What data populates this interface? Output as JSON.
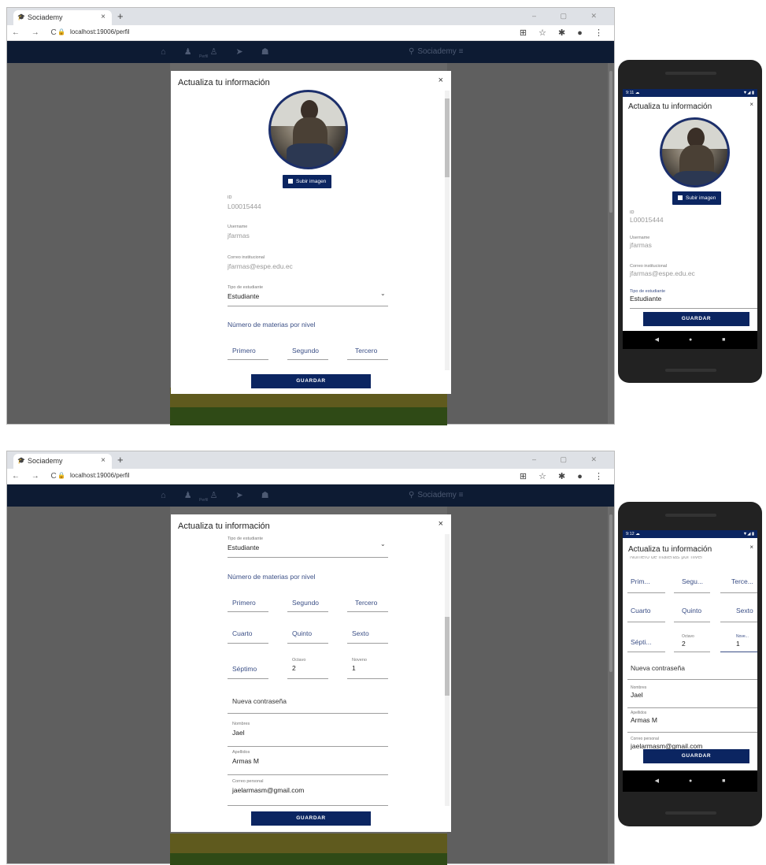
{
  "browser": {
    "tab_title": "Sociademy",
    "tab_close": "×",
    "new_tab": "+",
    "window_controls": "– ▢ ✕",
    "nav_buttons": "← → C",
    "url": "localhost:19006/perfil",
    "lock": "🔒",
    "extensions": "⊞ ☆ ✱ ● ⋮",
    "tab_favicon": "🎓"
  },
  "appnav": {
    "icons": "⌂ ♟ ♙ ➤ ☗",
    "perfil_label": "Perfil",
    "search_icon": "⚲",
    "brand": "Sociademy",
    "menu_icon": "≡"
  },
  "modal": {
    "title": "Actualiza tu información",
    "close": "×",
    "upload_button": "Subir imagen",
    "save_button": "GUARDAR",
    "fields": {
      "id_label": "ID",
      "id_value": "L00015444",
      "username_label": "Username",
      "username_value": "jfarmas",
      "correo_label": "Correo institucional",
      "correo_value": "jfarmas@espe.edu.ec",
      "tipo_label": "Tipo de estudiante",
      "tipo_value": "Estudiante",
      "materias_heading": "Número de materias por nivel",
      "primero": "Primero",
      "segundo": "Segundo",
      "tercero": "Tercero",
      "cuarto": "Cuarto",
      "quinto": "Quinto",
      "sexto": "Sexto",
      "septimo": "Séptimo",
      "octavo_label": "Octavo",
      "octavo_value": "2",
      "noveno_label": "Noveno",
      "noveno_value": "1",
      "nueva_contrasena": "Nueva contraseña",
      "nombres_label": "Nombres",
      "nombres_value": "Jael",
      "apellidos_label": "Apellidos",
      "apellidos_value": "Armas M",
      "correo_personal_label": "Correo personal",
      "correo_personal_value": "jaelarmasm@gmail.com"
    }
  },
  "phone1": {
    "time": "9:11 ☁",
    "status_right": "▼◢ ▮",
    "title": "Actualiza tu información",
    "close": "×",
    "upload_button": "Subir imagen",
    "save_button": "GUARDAR",
    "nav": "◀ ● ■"
  },
  "phone2": {
    "time": "9:12 ☁",
    "status_right": "▼◢ ▮",
    "title": "Actualiza tu información",
    "close": "×",
    "cut_text": "Número de materias por nivel",
    "primero": "Prim...",
    "segundo": "Segu...",
    "tercero": "Terce...",
    "cuarto": "Cuarto",
    "quinto": "Quinto",
    "sexto": "Sexto",
    "septimo": "Sépti...",
    "octavo_label": "Octavo",
    "octavo_value": "2",
    "noveno_label": "Nove...",
    "noveno_value": "1",
    "nueva_contrasena": "Nueva contraseña",
    "nombres_label": "Nombres",
    "nombres_value": "Jael",
    "apellidos_label": "Apellidos",
    "apellidos_value": "Armas M",
    "correo_label": "Correo personal",
    "correo_value": "jaelarmasm@gmail.com",
    "save_button": "GUARDAR",
    "nav": "◀ ● ■"
  },
  "colors": {
    "primary": "#0b2561",
    "appnav": "#0d1b33",
    "accent_text": "#3b4f86"
  }
}
